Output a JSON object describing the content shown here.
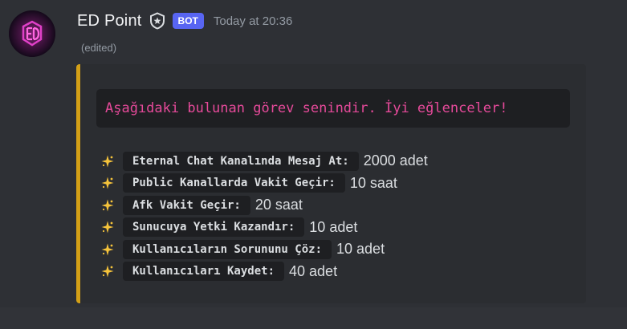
{
  "message": {
    "author": "ED Point",
    "bot_tag": "BOT",
    "timestamp": "Today at 20:36",
    "edited": "(edited)",
    "avatar_icon": "ed-point-logo-icon",
    "verified_icon": "shield-badge-icon"
  },
  "embed": {
    "accent_color": "#d4a017",
    "intro": "Aşağıdaki bulunan görev senindir. İyi eğlenceler!",
    "task_icon": "sparkle-icon",
    "tasks": [
      {
        "name": "Eternal Chat Kanalında Mesaj At:",
        "value": "2000 adet"
      },
      {
        "name": "Public Kanallarda Vakit Geçir:",
        "value": "10 saat"
      },
      {
        "name": "Afk Vakit Geçir:",
        "value": "20 saat"
      },
      {
        "name": "Sunucuya Yetki Kazandır:",
        "value": "10 adet"
      },
      {
        "name": "Kullanıcıların Sorununu Çöz:",
        "value": "10 adet"
      },
      {
        "name": "Kullanıcıları Kaydet:",
        "value": "40 adet"
      }
    ]
  }
}
